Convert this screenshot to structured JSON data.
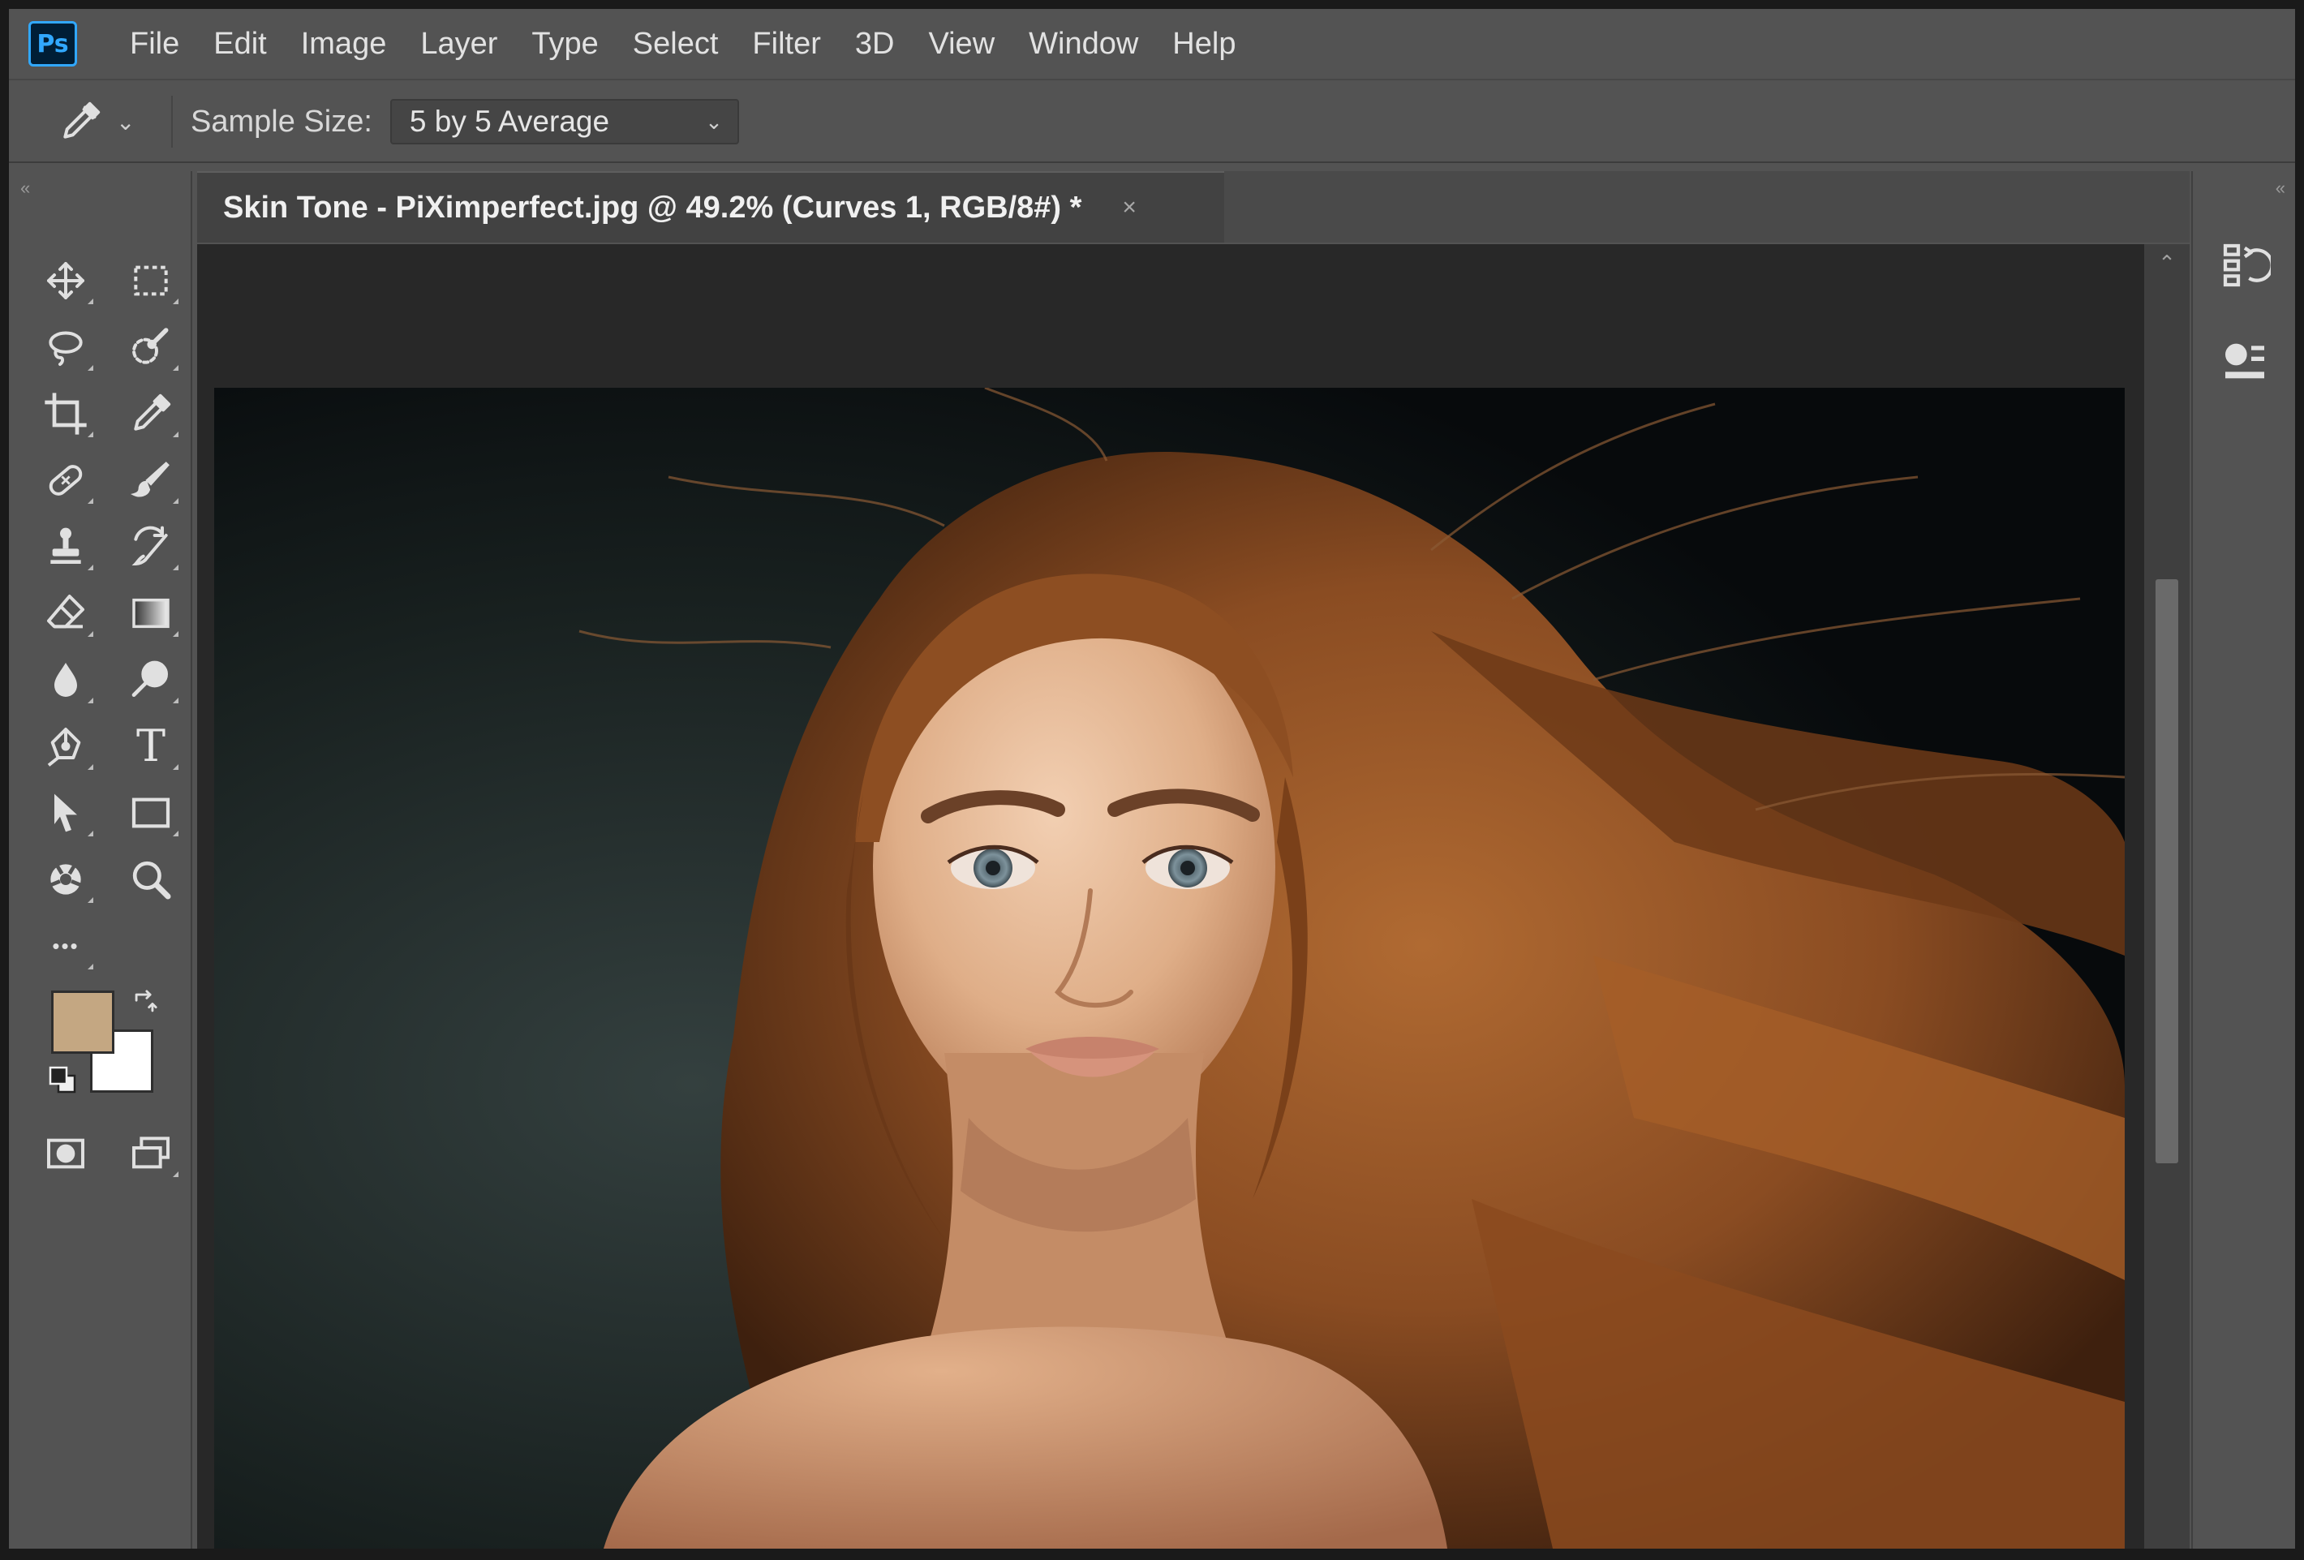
{
  "app": {
    "logo": "Ps"
  },
  "menu": [
    "File",
    "Edit",
    "Image",
    "Layer",
    "Type",
    "Select",
    "Filter",
    "3D",
    "View",
    "Window",
    "Help"
  ],
  "options": {
    "tool_icon": "eyedropper-icon",
    "sample_size_label": "Sample Size:",
    "sample_size_value": "5 by 5 Average"
  },
  "document": {
    "tab_title": "Skin Tone - PiXimperfect.jpg @ 49.2% (Curves 1, RGB/8#) *",
    "close_glyph": "×",
    "zoom_percent": 49.2
  },
  "toolbar": {
    "tools": [
      "move-icon",
      "marquee-icon",
      "lasso-icon",
      "quick-selection-icon",
      "crop-icon",
      "eyedropper-icon",
      "healing-brush-icon",
      "brush-icon",
      "clone-stamp-icon",
      "history-brush-icon",
      "eraser-icon",
      "gradient-icon",
      "blur-icon",
      "dodge-icon",
      "pen-icon",
      "type-icon",
      "path-selection-icon",
      "rectangle-icon",
      "hand-icon",
      "zoom-icon",
      "more-tools-icon"
    ],
    "foreground_color": "#c4a782",
    "background_color": "#ffffff",
    "type_glyph": "T",
    "more_glyph": "•••"
  },
  "colors": {
    "ui_bg": "#535353",
    "pasteboard": "#282828",
    "accent": "#31a8ff"
  },
  "dock": [
    "history-panel-icon",
    "properties-panel-icon"
  ],
  "scroll_fraction": 0.45
}
